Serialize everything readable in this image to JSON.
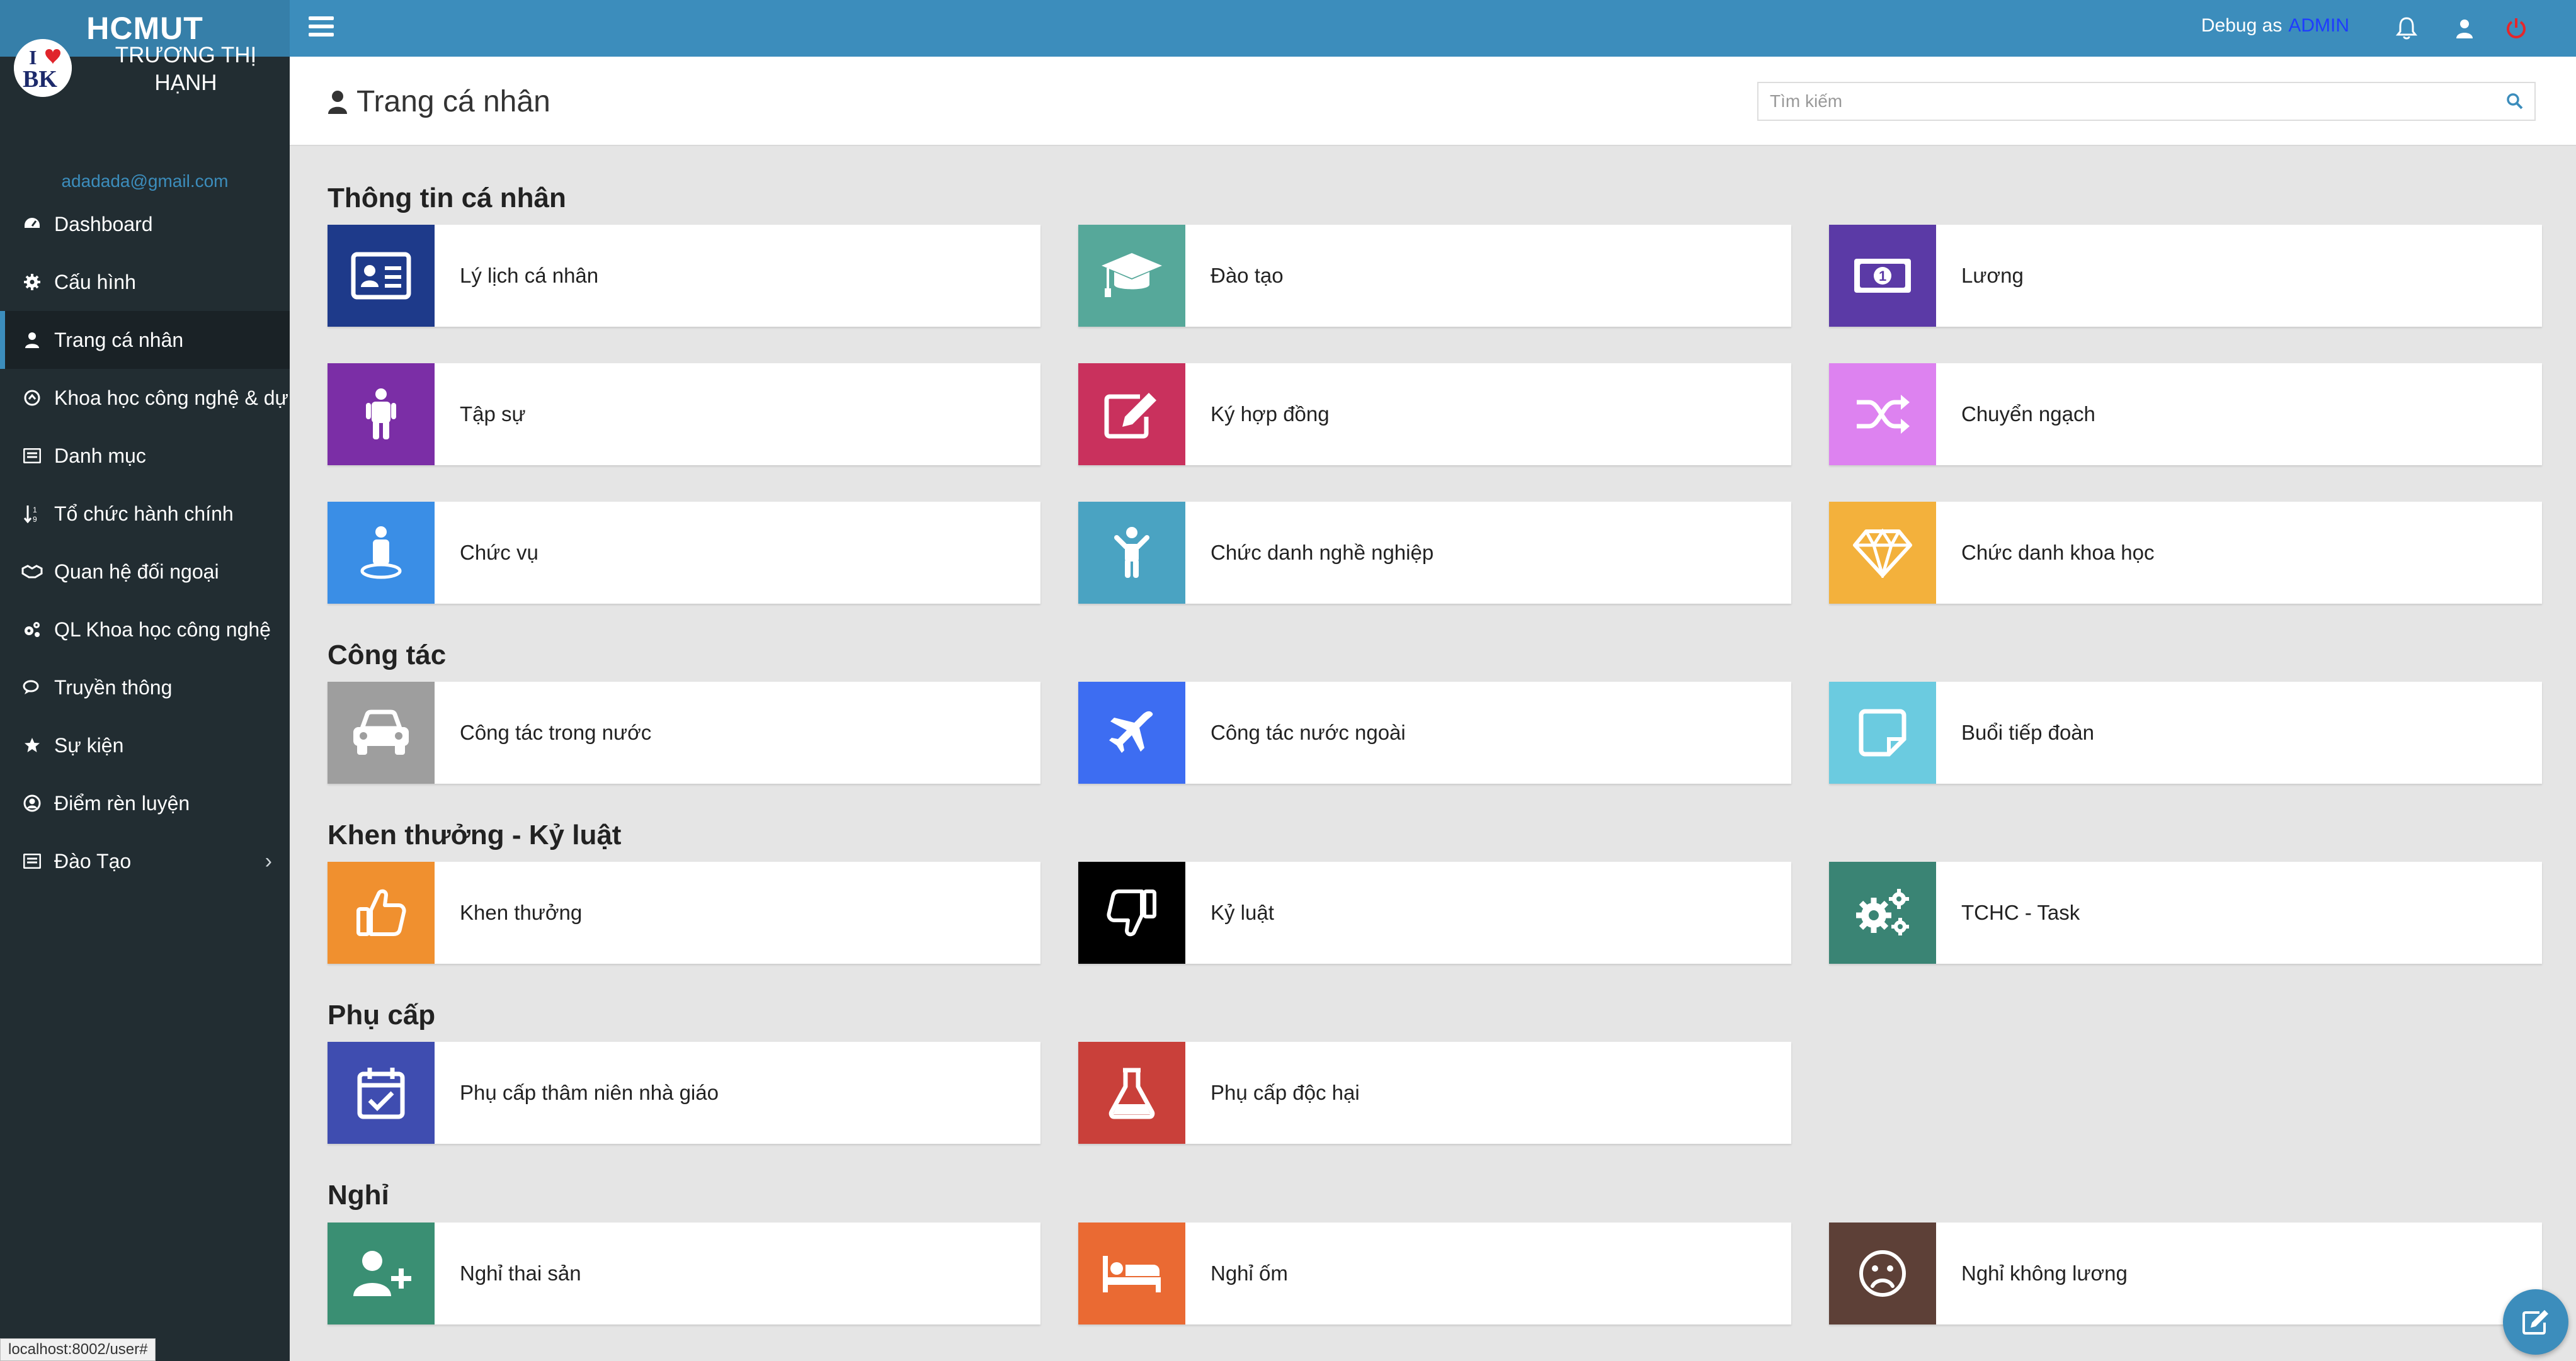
{
  "app": {
    "brand": "HCMUT"
  },
  "user": {
    "name": "TRƯƠNG THỊ HẠNH",
    "email": "adadada@gmail.com",
    "avatar_text_top": "I",
    "avatar_text_bottom": "BK"
  },
  "sidebar": {
    "items": [
      {
        "label": "Dashboard",
        "icon": "dashboard-icon"
      },
      {
        "label": "Cấu hình",
        "icon": "gear-icon"
      },
      {
        "label": "Trang cá nhân",
        "icon": "user-icon",
        "active": true
      },
      {
        "label": "Khoa học công nghệ & dự án",
        "icon": "science-icon"
      },
      {
        "label": "Danh mục",
        "icon": "list-icon"
      },
      {
        "label": "Tổ chức hành chính",
        "icon": "sort-icon"
      },
      {
        "label": "Quan hệ đối ngoại",
        "icon": "handshake-icon"
      },
      {
        "label": "QL Khoa học công nghệ",
        "icon": "cogs-icon"
      },
      {
        "label": "Truyền thông",
        "icon": "comments-icon"
      },
      {
        "label": "Sự kiện",
        "icon": "star-icon"
      },
      {
        "label": "Điểm rèn luyện",
        "icon": "user-circle-icon"
      },
      {
        "label": "Đào Tạo",
        "icon": "list-alt-icon",
        "chevron": "›"
      }
    ]
  },
  "topbar": {
    "debug_label": "Debug as",
    "debug_role": "ADMIN"
  },
  "header": {
    "title": "Trang cá nhân",
    "search_placeholder": "Tìm kiếm"
  },
  "sections": [
    {
      "title": "Thông tin cá nhân",
      "cards": [
        {
          "label": "Lý lịch cá nhân",
          "color": "#1e3a8a",
          "icon": "id-card-icon"
        },
        {
          "label": "Đào tạo",
          "color": "#56a89a",
          "icon": "graduation-cap-icon"
        },
        {
          "label": "Lương",
          "color": "#5b3aa6",
          "icon": "money-bill-icon"
        },
        {
          "label": "Tập sự",
          "color": "#7b2ea6",
          "icon": "child-icon"
        },
        {
          "label": "Ký hợp đồng",
          "color": "#c9315d",
          "icon": "edit-icon"
        },
        {
          "label": "Chuyển ngạch",
          "color": "#dd82f0",
          "icon": "random-icon"
        },
        {
          "label": "Chức vụ",
          "color": "#3a8ee6",
          "icon": "user-pin-icon"
        },
        {
          "label": "Chức danh nghề nghiệp",
          "color": "#4aa3c2",
          "icon": "child-raised-icon"
        },
        {
          "label": "Chức danh khoa học",
          "color": "#f3b13c",
          "icon": "gem-icon"
        }
      ]
    },
    {
      "title": "Công tác",
      "cards": [
        {
          "label": "Công tác trong nước",
          "color": "#9e9e9e",
          "icon": "car-icon"
        },
        {
          "label": "Công tác nước ngoài",
          "color": "#3d6df2",
          "icon": "plane-icon"
        },
        {
          "label": "Buổi tiếp đoàn",
          "color": "#6bcbe0",
          "icon": "sticky-note-icon"
        }
      ]
    },
    {
      "title": "Khen thưởng - Kỷ luật",
      "cards": [
        {
          "label": "Khen thưởng",
          "color": "#f0902f",
          "icon": "thumbs-up-icon"
        },
        {
          "label": "Kỷ luật",
          "color": "#000000",
          "icon": "thumbs-down-icon"
        },
        {
          "label": "TCHC - Task",
          "color": "#3a8474",
          "icon": "cogs-icon"
        }
      ]
    },
    {
      "title": "Phụ cấp",
      "cards": [
        {
          "label": "Phụ cấp thâm niên nhà giáo",
          "color": "#3f4db0",
          "icon": "calendar-check-icon"
        },
        {
          "label": "Phụ cấp độc hại",
          "color": "#c9403a",
          "icon": "flask-icon"
        }
      ]
    },
    {
      "title": "Nghỉ",
      "cards": [
        {
          "label": "Nghỉ thai sản",
          "color": "#3a8f73",
          "icon": "user-plus-icon"
        },
        {
          "label": "Nghỉ ốm",
          "color": "#ea6a33",
          "icon": "bed-icon"
        },
        {
          "label": "Nghỉ không lương",
          "color": "#5d4037",
          "icon": "frown-icon"
        }
      ]
    }
  ],
  "status_bar": {
    "url": "localhost:8002/user#"
  }
}
